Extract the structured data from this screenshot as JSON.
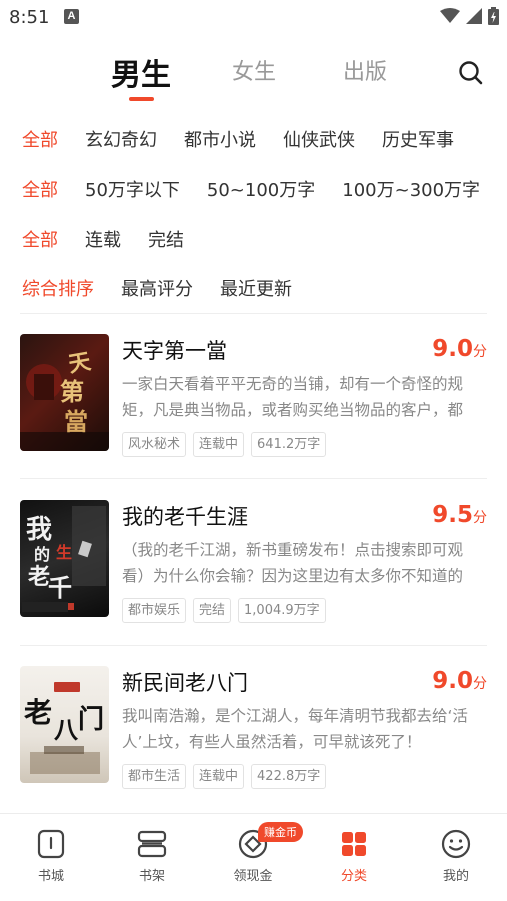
{
  "status": {
    "time": "8:51",
    "notif_letter": "A"
  },
  "header": {
    "tabs": [
      {
        "label": "男生"
      },
      {
        "label": "女生"
      },
      {
        "label": "出版"
      }
    ],
    "active_tab": "男生"
  },
  "filters": {
    "category": [
      "全部",
      "玄幻奇幻",
      "都市小说",
      "仙侠武侠",
      "历史军事"
    ],
    "word_count": [
      "全部",
      "50万字以下",
      "50~100万字",
      "100万~300万字"
    ],
    "status": [
      "全部",
      "连载",
      "完结"
    ],
    "sort": [
      "综合排序",
      "最高评分",
      "最近更新"
    ],
    "selected": {
      "category": "全部",
      "word_count": "全部",
      "status": "全部",
      "sort": "综合排序"
    }
  },
  "books": [
    {
      "title": "天字第一當",
      "score": "9.0",
      "score_unit": "分",
      "description": "一家白天看着平平无奇的当铺，却有一个奇怪的规矩，凡是典当物品，或者购买绝当物品的客户，都",
      "tags": [
        "风水秘术",
        "连载中",
        "641.2万字"
      ],
      "cover_text": "天字第一當"
    },
    {
      "title": "我的老千生涯",
      "score": "9.5",
      "score_unit": "分",
      "description": "（我的老千江湖，新书重磅发布！点击搜索即可观看）为什么你会输？因为这里边有太多你不知道的",
      "tags": [
        "都市娱乐",
        "完结",
        "1,004.9万字"
      ],
      "cover_text": "我的老千生涯"
    },
    {
      "title": "新民间老八门",
      "score": "9.0",
      "score_unit": "分",
      "description": "我叫南浩瀚，是个江湖人，每年清明节我都去给‘活人’上坟，有些人虽然活着，可早就该死了！",
      "tags": [
        "都市生活",
        "连载中",
        "422.8万字"
      ],
      "cover_text": "老八门"
    }
  ],
  "bottom_nav": [
    {
      "label": "书城",
      "icon": "book-icon"
    },
    {
      "label": "书架",
      "icon": "bookshelf-icon"
    },
    {
      "label": "领现金",
      "icon": "coin-icon",
      "badge": "赚金币"
    },
    {
      "label": "分类",
      "icon": "category-grid-icon"
    },
    {
      "label": "我的",
      "icon": "smiley-icon"
    }
  ],
  "colors": {
    "accent": "#f0492b",
    "text": "#222222",
    "muted": "#888888"
  }
}
